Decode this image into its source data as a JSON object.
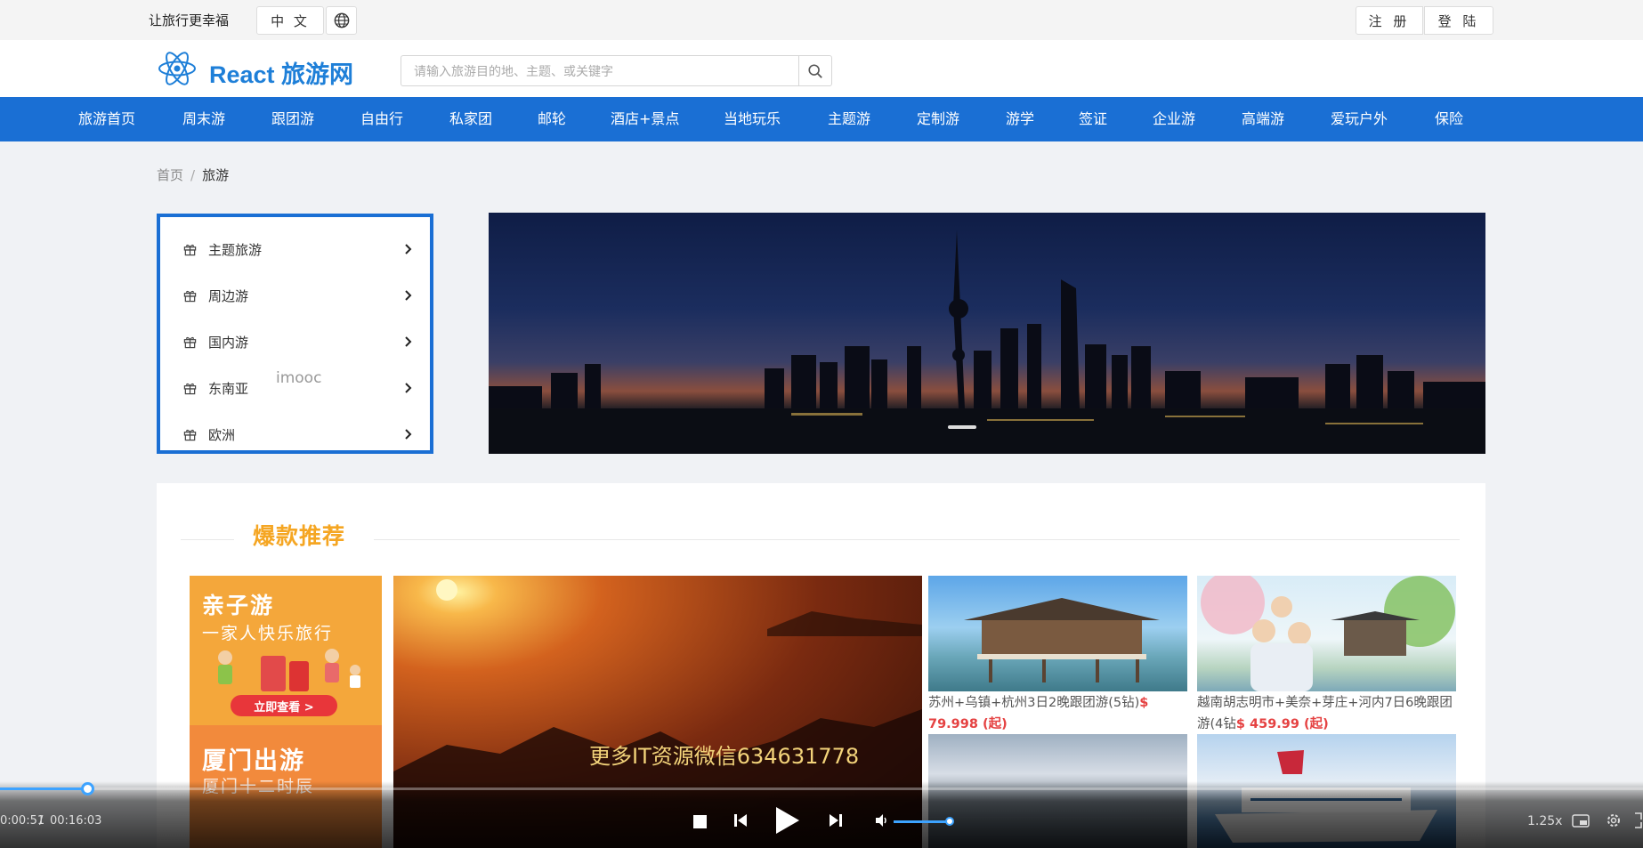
{
  "topbar": {
    "slogan": "让旅行更幸福",
    "language": "中 文",
    "register": "注 册",
    "login": "登 陆"
  },
  "header": {
    "site_title": "React 旅游网",
    "search_placeholder": "请输入旅游目的地、主题、或关键字"
  },
  "nav": [
    "旅游首页",
    "周末游",
    "跟团游",
    "自由行",
    "私家团",
    "邮轮",
    "酒店+景点",
    "当地玩乐",
    "主题游",
    "定制游",
    "游学",
    "签证",
    "企业游",
    "高端游",
    "爱玩户外",
    "保险"
  ],
  "breadcrumb": {
    "home": "首页",
    "separator": "/",
    "current": "旅游"
  },
  "side_menu": [
    {
      "label": "主题旅游",
      "icon": "gift-icon"
    },
    {
      "label": "周边游",
      "icon": "gift-icon"
    },
    {
      "label": "国内游",
      "icon": "gift-icon"
    },
    {
      "label": "东南亚",
      "icon": "gift-icon"
    },
    {
      "label": "欧洲",
      "icon": "gift-icon"
    }
  ],
  "watermark_imooc": "imooc",
  "hot": {
    "title": "爆款推荐",
    "promo_family": {
      "title": "亲子游",
      "subtitle": "一家人快乐旅行",
      "button": "立即查看 >"
    },
    "promo_xiamen": {
      "title": "厦门出游",
      "subtitle": "厦门十二时辰"
    },
    "watermark": "更多IT资源微信634631778",
    "products": [
      {
        "desc": "苏州+乌镇+杭州3日2晚跟团游(5钻)",
        "price": "$ 79.998 (起)"
      },
      {
        "desc": "越南胡志明市+美奈+芽庄+河内7日6晚跟团游(4钻",
        "price": "$ 459.99 (起)"
      }
    ]
  },
  "player": {
    "current_time": "0:00:51",
    "separator": "/",
    "total_time": "00:16:03",
    "speed": "1.25x",
    "progress": 0.053,
    "volume": 1.0
  },
  "colors": {
    "nav_blue": "#1a6fd4",
    "brand_blue": "#1e7fd8",
    "hot_orange": "#f5a623",
    "price_red": "#e54242"
  }
}
